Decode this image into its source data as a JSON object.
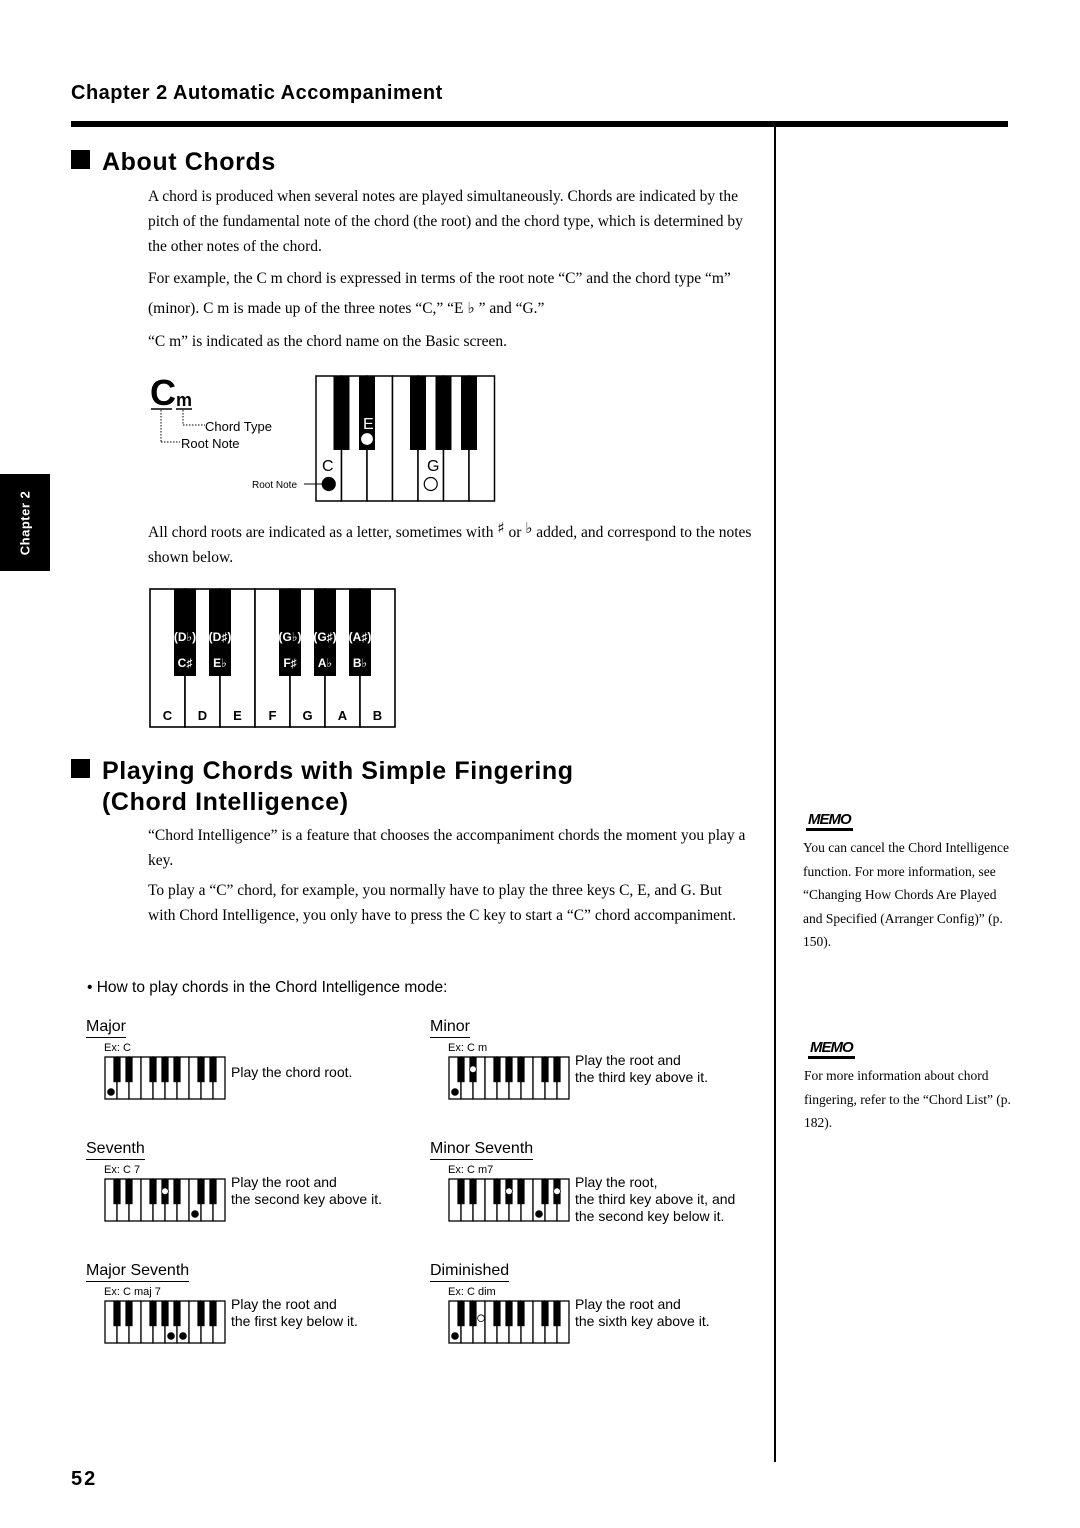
{
  "header": {
    "chapter_title": "Chapter 2  Automatic Accompaniment",
    "side_tab": "Chapter 2"
  },
  "section1": {
    "title": "About Chords",
    "paragraphs": [
      "A chord is produced when several notes are played simultaneously. Chords are indicated by the pitch of the fundamental note of the chord (the root) and the chord type, which is determined by the other notes of the chord.",
      "For example, the C m chord is expressed in terms of the root note “C” and the chord type “m” (minor). C m is made up of the three notes “C,” “E ♭ ” and “G.”",
      "“C m” is indicated as the chord name on the Basic screen."
    ],
    "cm_diagram": {
      "root": "C",
      "type": "m",
      "chord_type_label": "Chord Type",
      "root_note_label": "Root Note",
      "key_root_note_label": "Root Note",
      "note_labels": [
        "C",
        "E♭",
        "G"
      ]
    },
    "roots_paragraph_a": "All chord roots are indicated as a letter, sometimes with",
    "sharp_symbol": "♯",
    "or_word": "or",
    "flat_symbol": "♭",
    "roots_paragraph_b": "added, and correspond to the notes shown below.",
    "keyboard": {
      "white_keys": [
        "C",
        "D",
        "E",
        "F",
        "G",
        "A",
        "B"
      ],
      "black_keys": [
        {
          "alt": "(D♭)",
          "name": "C♯"
        },
        {
          "alt": "(D♯)",
          "name": "E♭"
        },
        {
          "alt": "(G♭)",
          "name": "F♯"
        },
        {
          "alt": "(G♯)",
          "name": "A♭"
        },
        {
          "alt": "(A♯)",
          "name": "B♭"
        }
      ]
    }
  },
  "section2": {
    "title_line1": "Playing Chords with Simple Fingering",
    "title_line2": "(Chord Intelligence)",
    "paragraphs": [
      "“Chord Intelligence” is a feature that chooses the accompaniment chords the moment you play a key.",
      "To play a “C” chord, for example, you normally have to play the three keys C, E, and G. But with Chord Intelligence, you only have to press the C key to start a “C” chord accompaniment."
    ],
    "how_to": "• How to play chords in the Chord Intelligence mode:",
    "chord_types": [
      {
        "title": "Major",
        "example": "Ex:  C",
        "desc": [
          "Play the chord root."
        ]
      },
      {
        "title": "Minor",
        "example": "Ex:  C m",
        "desc": [
          "Play the root and",
          "the third key above it."
        ]
      },
      {
        "title": "Seventh",
        "example": "Ex:  C 7",
        "desc": [
          "Play the root and",
          "the second key above it."
        ]
      },
      {
        "title": "Minor Seventh",
        "example": "Ex:  C m7",
        "desc": [
          "Play the root,",
          "the third key above it, and",
          "the second key below it."
        ]
      },
      {
        "title": "Major Seventh",
        "example": "Ex:  C maj 7",
        "desc": [
          "Play the root and",
          "the first key below it."
        ]
      },
      {
        "title": "Diminished",
        "example": "Ex:  C dim",
        "desc": [
          "Play the root and",
          "the sixth key above it."
        ]
      }
    ]
  },
  "memos": [
    {
      "icon": "MEMO",
      "text": "You can cancel the Chord Intelligence function. For more information, see “Changing How Chords Are Played and Specified (Arranger Config)” (p. 150)."
    },
    {
      "icon": "MEMO",
      "text": "For more information about chord fingering, refer to the “Chord List” (p. 182)."
    }
  ],
  "footer": {
    "page_number": "52"
  }
}
